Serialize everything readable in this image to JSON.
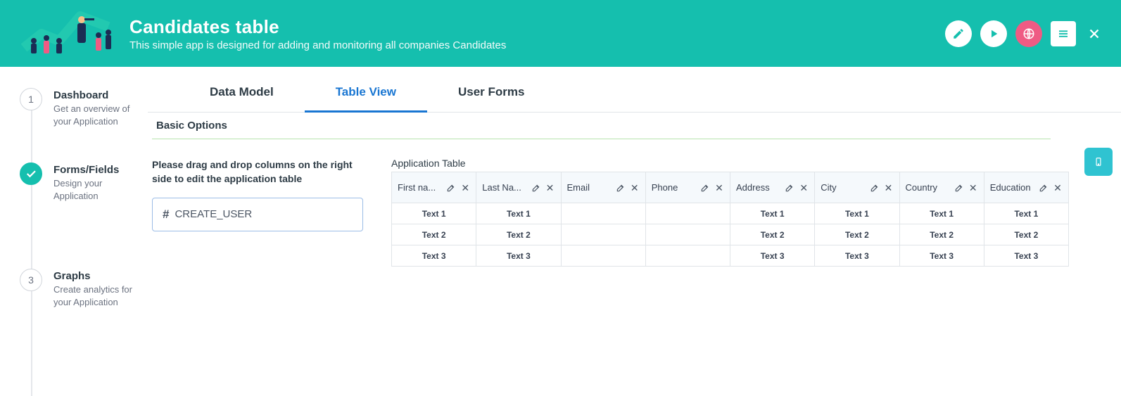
{
  "header": {
    "title": "Candidates table",
    "subtitle": "This simple app is designed for adding and monitoring all companies Candidates"
  },
  "sidebar": {
    "steps": [
      {
        "num": "1",
        "title": "Dashboard",
        "desc": "Get an overview of your Application",
        "active": false
      },
      {
        "num": "2",
        "title": "Forms/Fields",
        "desc": "Design your Application",
        "active": true
      },
      {
        "num": "3",
        "title": "Graphs",
        "desc": "Create analytics for your Application",
        "active": false
      }
    ]
  },
  "tabs": {
    "items": [
      {
        "label": "Data Model",
        "active": false
      },
      {
        "label": "Table View",
        "active": true
      },
      {
        "label": "User Forms",
        "active": false
      }
    ]
  },
  "section": {
    "label": "Basic Options"
  },
  "drag": {
    "hint": "Please drag and drop columns on the right side to edit the application table",
    "slot_prefix": "#",
    "slot_value": "CREATE_USER"
  },
  "table": {
    "title": "Application Table",
    "columns": [
      {
        "label": "First na..."
      },
      {
        "label": "Last Na..."
      },
      {
        "label": "Email"
      },
      {
        "label": "Phone"
      },
      {
        "label": "Address"
      },
      {
        "label": "City"
      },
      {
        "label": "Country"
      },
      {
        "label": "Education"
      }
    ],
    "rows": [
      [
        "Text 1",
        "Text 1",
        "",
        "",
        "Text 1",
        "Text 1",
        "Text 1",
        "Text 1"
      ],
      [
        "Text 2",
        "Text 2",
        "",
        "",
        "Text 2",
        "Text 2",
        "Text 2",
        "Text 2"
      ],
      [
        "Text 3",
        "Text 3",
        "",
        "",
        "Text 3",
        "Text 3",
        "Text 3",
        "Text 3"
      ]
    ]
  }
}
